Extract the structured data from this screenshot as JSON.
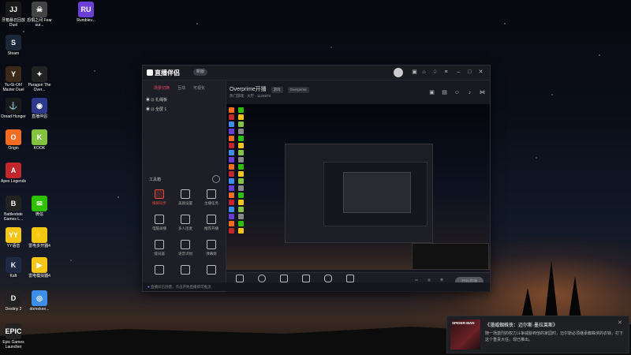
{
  "desktop": {
    "icons": [
      {
        "id": "jjjt",
        "label": "牙箱暴召回放 Duel",
        "color": "#1a1a1a",
        "glyph": "JJ"
      },
      {
        "id": "fear",
        "label": "恐惧之间 Fear sur...",
        "color": "#444",
        "glyph": "☠"
      },
      {
        "id": "rumble",
        "label": "Rumblev...",
        "color": "#6b3fd6",
        "glyph": "RU"
      },
      {
        "id": "steam",
        "label": "Steam",
        "color": "#1b2838",
        "glyph": "S"
      },
      {
        "id": "yugioh",
        "label": "Yu-Gi-Oh! Master Duel",
        "color": "#3b2a1a",
        "glyph": "Y"
      },
      {
        "id": "paragon",
        "label": "Paragon The Over...",
        "color": "#222",
        "glyph": "✦"
      },
      {
        "id": "duzhong",
        "label": "直播伴侣",
        "color": "#2d3a8c",
        "glyph": "◉"
      },
      {
        "id": "dread",
        "label": "Dread Hunger",
        "color": "#1a1a1a",
        "glyph": "⚓"
      },
      {
        "id": "origin",
        "label": "Origin",
        "color": "#f26d21",
        "glyph": "O"
      },
      {
        "id": "kook",
        "label": "KOOK",
        "color": "#84c341",
        "glyph": "K"
      },
      {
        "id": "apex",
        "label": "Apex Legends",
        "color": "#c1272d",
        "glyph": "A"
      },
      {
        "id": "battlestate",
        "label": "Battlestate Games L...",
        "color": "#222",
        "glyph": "B"
      },
      {
        "id": "wechat",
        "label": "微信",
        "color": "#2dc100",
        "glyph": "✉"
      },
      {
        "id": "yy",
        "label": "YY语音",
        "color": "#f5c518",
        "glyph": "YY"
      },
      {
        "id": "leidian1",
        "label": "雷电多开器4",
        "color": "#f2c811",
        "glyph": "⚡"
      },
      {
        "id": "kaft",
        "label": "Kaft",
        "color": "#1e2a44",
        "glyph": "K"
      },
      {
        "id": "leidian2",
        "label": "雷电模拟器4",
        "color": "#f5c518",
        "glyph": "▶"
      },
      {
        "id": "destiny",
        "label": "Destiny 2",
        "color": "#222",
        "glyph": "D"
      },
      {
        "id": "domekee",
        "label": "domekee...",
        "color": "#3d8ee8",
        "glyph": "◎"
      },
      {
        "id": "epic",
        "label": "Epic Games Launcher",
        "color": "#222",
        "glyph": "EPIC"
      }
    ]
  },
  "app": {
    "title": "直播伴侣",
    "version": "新版",
    "left_tabs": [
      "场景切换",
      "互动",
      "可视化"
    ],
    "scenes": [
      "扎绳板",
      "全屏 1"
    ],
    "tools_header": "工具箱",
    "tools": [
      "横屏同步",
      "美颜设置",
      "主播任务",
      "电脑录播",
      "多人连麦",
      "推荐开播",
      "提词器",
      "语音识别",
      "弹幕姬",
      "",
      "",
      ""
    ],
    "stream_title": "Overprime开播",
    "title_tag": "游戏",
    "title_game": "Overprime",
    "sub_info": "热门游戏 · 大厅 · 1124870",
    "bottom_buttons": [
      "直播间",
      "摄像头",
      "手机投屏",
      "多窗口",
      "麦克风",
      "扬声器"
    ],
    "start_button": "开始直播",
    "status_text": "直播间已创建，点击开始直播即可推流"
  },
  "notification": {
    "thumb_label": "SPIDER-MAN",
    "title": "《漫威蜘蛛侠：迈尔斯·墨拉莱斯》",
    "body": "随一场激烈的权力斗争威胁到他的家园时，迈尔斯必须继承蜘蛛侠的衣钵，打下这个重责大任。现已推出。"
  }
}
